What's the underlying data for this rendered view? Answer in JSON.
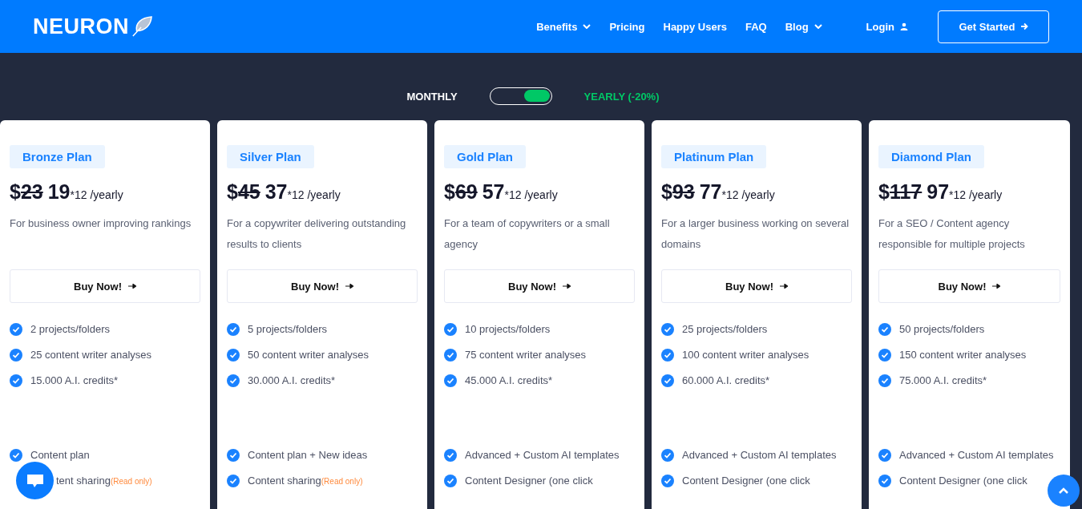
{
  "header": {
    "logo": "NEURON",
    "nav": [
      {
        "label": "Benefits",
        "dropdown": true
      },
      {
        "label": "Pricing",
        "dropdown": false
      },
      {
        "label": "Happy Users",
        "dropdown": false
      },
      {
        "label": "FAQ",
        "dropdown": false
      },
      {
        "label": "Blog",
        "dropdown": true
      }
    ],
    "login": "Login",
    "cta": "Get Started"
  },
  "billing": {
    "monthly": "MONTHLY",
    "yearly": "YEARLY (-20%)",
    "yearly_selected": true
  },
  "plans": [
    {
      "name": "Bronze Plan",
      "currency": "$",
      "old_price": "23",
      "price": "19",
      "suffix": "*12 /yearly",
      "description": "For business owner improving rankings",
      "button": "Buy Now!",
      "features": [
        {
          "text": "2 projects/folders"
        },
        {
          "text": "25 content writer analyses"
        },
        {
          "text": "15.000 A.I. credits*"
        }
      ],
      "extras": [
        {
          "text": "Content plan",
          "covered": false
        },
        {
          "text": "tent sharing",
          "note": "(Read only)",
          "covered": true
        }
      ]
    },
    {
      "name": "Silver Plan",
      "currency": "$",
      "old_price": "45",
      "price": "37",
      "suffix": "*12 /yearly",
      "description": "For a copywriter delivering outstanding results to clients",
      "button": "Buy Now!",
      "features": [
        {
          "text": "5 projects/folders"
        },
        {
          "text": "50 content writer analyses"
        },
        {
          "text": "30.000 A.I. credits*"
        }
      ],
      "extras": [
        {
          "text": "Content plan + New ideas",
          "covered": false
        },
        {
          "text": "Content sharing",
          "note": "(Read only)",
          "covered": false
        }
      ]
    },
    {
      "name": "Gold Plan",
      "currency": "$",
      "old_price": "69",
      "price": "57",
      "suffix": "*12 /yearly",
      "description": "For a team of copywriters or a small agency",
      "button": "Buy Now!",
      "features": [
        {
          "text": "10 projects/folders"
        },
        {
          "text": "75 content writer analyses"
        },
        {
          "text": "45.000 A.I. credits*"
        }
      ],
      "extras": [
        {
          "text": "Advanced + Custom AI templates",
          "covered": false
        },
        {
          "text": "Content Designer (one click",
          "covered": false
        }
      ]
    },
    {
      "name": "Platinum Plan",
      "currency": "$",
      "old_price": "93",
      "price": "77",
      "suffix": "*12 /yearly",
      "description": "For a larger business working on several domains",
      "button": "Buy Now!",
      "features": [
        {
          "text": "25 projects/folders"
        },
        {
          "text": "100 content writer analyses"
        },
        {
          "text": "60.000 A.I. credits*"
        }
      ],
      "extras": [
        {
          "text": "Advanced + Custom AI templates",
          "covered": false
        },
        {
          "text": "Content Designer (one click",
          "covered": false
        }
      ]
    },
    {
      "name": "Diamond Plan",
      "currency": "$",
      "old_price": "117",
      "price": "97",
      "suffix": "*12 /yearly",
      "description": "For a SEO / Content agency responsible for multiple projects",
      "button": "Buy Now!",
      "features": [
        {
          "text": "50 projects/folders"
        },
        {
          "text": "150 content writer analyses"
        },
        {
          "text": "75.000 A.I. credits*"
        }
      ],
      "extras": [
        {
          "text": "Advanced + Custom AI templates",
          "covered": false
        },
        {
          "text": "Content Designer (one click",
          "covered": false
        }
      ]
    }
  ]
}
